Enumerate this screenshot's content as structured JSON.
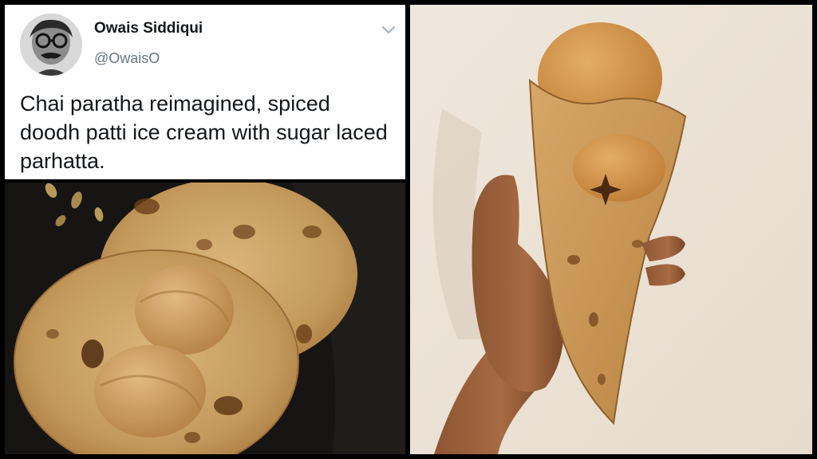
{
  "tweet": {
    "author_name": "Owais Siddiqui",
    "author_handle": "@OwaisO",
    "text": "Chai paratha reimagined, spiced doodh patti ice cream with sugar laced parhatta.",
    "menu_icon": "chevron-down-icon",
    "avatar_icon": "avatar"
  },
  "colors": {
    "name": "#14171a",
    "handle": "#657786",
    "chevron": "#aab8c2",
    "border": "#000000"
  }
}
